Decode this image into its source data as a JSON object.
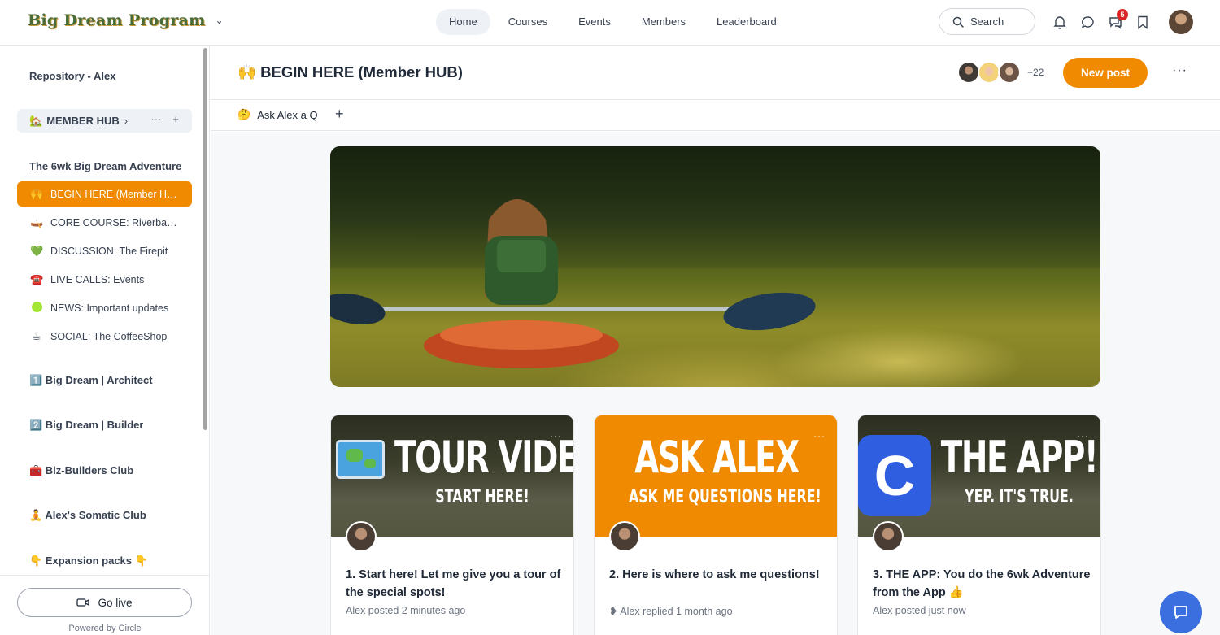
{
  "brand": {
    "name": "Big Dream Program"
  },
  "nav": {
    "items": [
      "Home",
      "Courses",
      "Events",
      "Members",
      "Leaderboard"
    ]
  },
  "search": {
    "label": "Search"
  },
  "notifications": {
    "chat_badge": "5"
  },
  "sidebar": {
    "repo": "Repository - Alex",
    "hub": {
      "emoji": "🏡",
      "label": "MEMBER HUB"
    },
    "section_title": "The 6wk Big Dream Adventure",
    "items": [
      {
        "emoji": "🙌",
        "label": "BEGIN HERE (Member HUB)"
      },
      {
        "emoji": "🛶",
        "label": "CORE COURSE: Riverbank Rally"
      },
      {
        "emoji": "💚",
        "label": "DISCUSSION: The Firepit"
      },
      {
        "emoji": "☎️",
        "label": "LIVE CALLS: Events"
      },
      {
        "emoji": "",
        "label": "NEWS: Important updates"
      },
      {
        "emoji": "☕",
        "label": "SOCIAL: The CoffeeShop"
      }
    ],
    "groups": [
      "1️⃣ Big Dream | Architect",
      "2️⃣ Big Dream | Builder",
      "🧰 Biz-Builders Club",
      "🧘 Alex's Somatic Club",
      "👇 Expansion packs 👇"
    ],
    "go_live": "Go live",
    "powered": "Powered by Circle"
  },
  "page": {
    "title": "🙌 BEGIN HERE (Member HUB)",
    "member_count": "+22",
    "new_post": "New post",
    "subtab": {
      "emoji": "🤔",
      "label": "Ask Alex a Q"
    }
  },
  "cards": [
    {
      "big": "TOUR VIDEO",
      "small": "START HERE!",
      "title": "1. Start here! Let me give you a tour of the special spots!",
      "meta": "Alex posted 2 minutes ago"
    },
    {
      "big": "ASK ALEX",
      "small": "ASK ME QUESTIONS HERE!",
      "title": "2. Here is where to ask me questions!",
      "meta": "❥ Alex replied 1 month ago"
    },
    {
      "big": "THE APP!",
      "small": "YEP. IT'S TRUE.",
      "title": "3. THE APP: You do the 6wk Adventure from the App 👍",
      "meta": "Alex posted just now"
    }
  ],
  "colors": {
    "accent": "#f08a00",
    "chat": "#3b6fe0"
  }
}
